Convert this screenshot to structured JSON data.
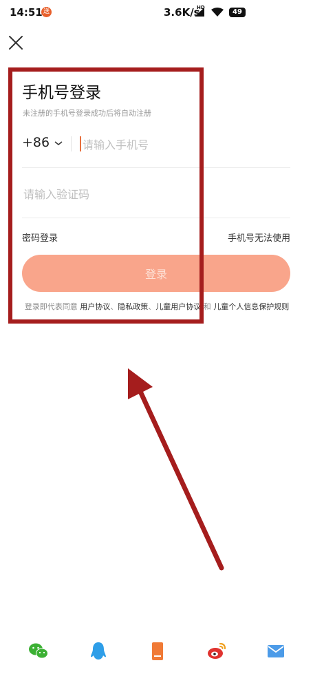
{
  "status_bar": {
    "time": "14:51",
    "badge": "送",
    "speed": "3.6K/s",
    "hd": "HD",
    "battery": "49"
  },
  "login": {
    "title": "手机号登录",
    "subtitle": "未注册的手机号登录成功后将自动注册",
    "country_code": "+86",
    "phone_placeholder": "请输入手机号",
    "code_placeholder": "请输入验证码",
    "password_login": "密码登录",
    "phone_unusable": "手机号无法使用",
    "login_button": "登录"
  },
  "agreement": {
    "prefix": "登录即代表同意",
    "user_agreement": "用户协议",
    "sep1": "、",
    "privacy_policy": "隐私政策",
    "sep2": "、",
    "child_agreement": "儿童用户协议",
    "and": "和",
    "child_privacy": "儿童个人信息保护规则"
  },
  "social_logins": [
    "wechat-icon",
    "qq-icon",
    "phone-icon",
    "weibo-icon",
    "mail-icon"
  ],
  "colors": {
    "accent": "#e76f3d",
    "button_bg": "#f9a58b",
    "annotation": "#a51d1d"
  }
}
